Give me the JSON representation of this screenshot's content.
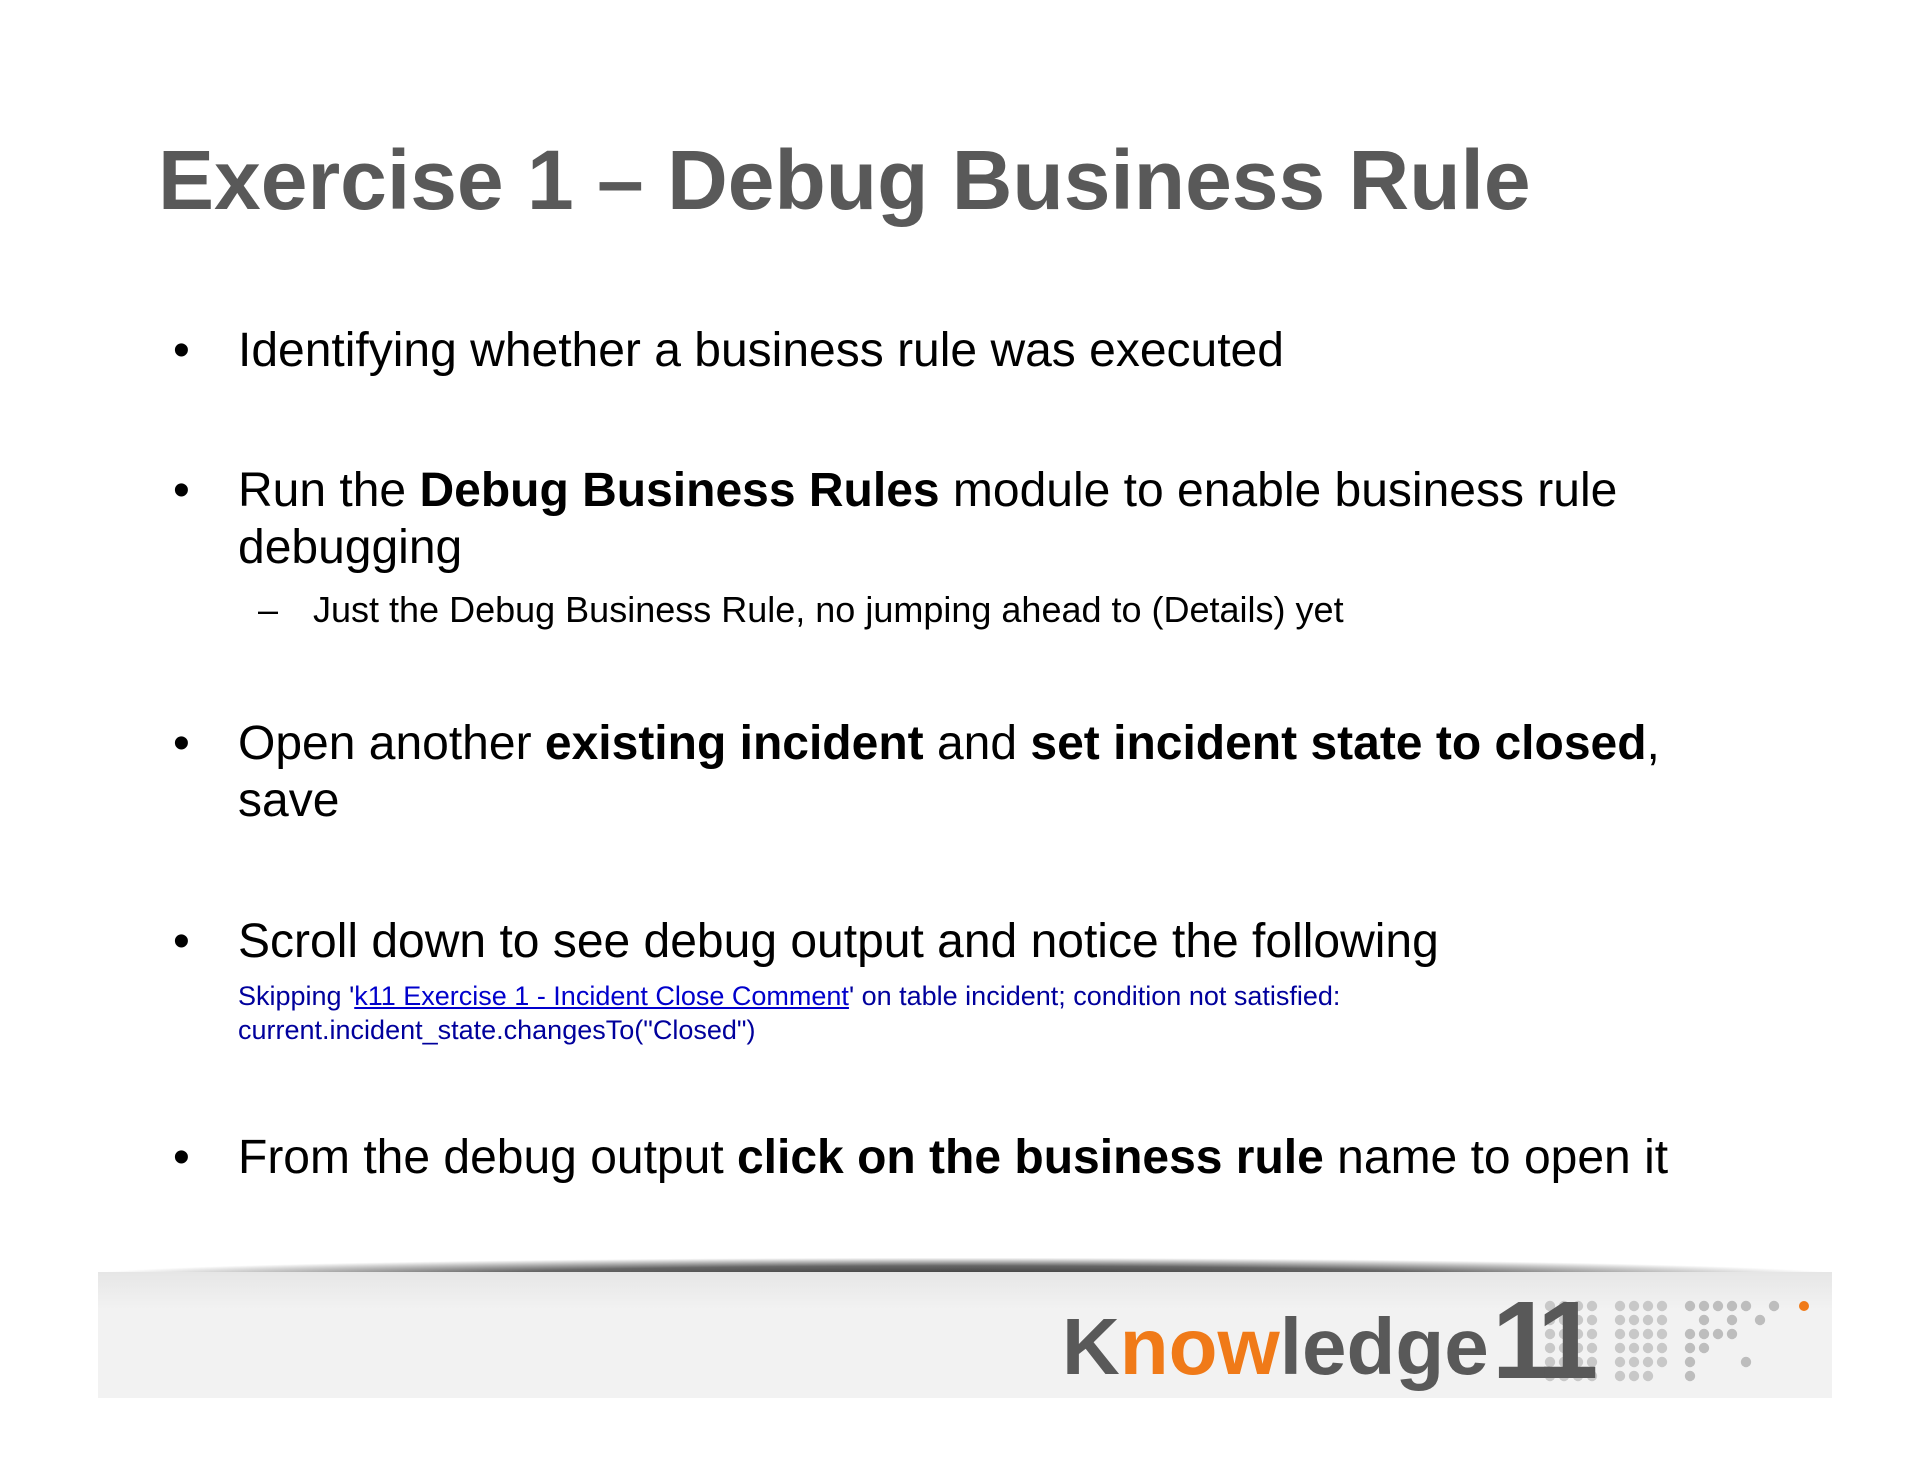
{
  "slide": {
    "title": "Exercise 1 – Debug Business Rule",
    "bullet_glyph": "•",
    "dash_glyph": "–",
    "bullets": [
      {
        "text": "Identifying whether a business rule was executed"
      },
      {
        "pre": "Run the ",
        "bold": "Debug Business Rules",
        "post": " module to enable business rule debugging",
        "sub": "Just the Debug Business Rule, no jumping ahead to (Details) yet"
      },
      {
        "pre": "Open another ",
        "bold1": "existing incident",
        "mid": " and ",
        "bold2": "set incident state to closed",
        "post": ", save"
      },
      {
        "text": "Scroll down to see debug output and notice the following",
        "debug": {
          "prefix": "Skipping '",
          "link": "k11 Exercise 1 - Incident Close Comment",
          "suffix": "' on table incident; condition not satisfied:",
          "line2": "current.incident_state.changesTo(\"Closed\")",
          "text_color": "#00009c",
          "link_color": "#0000cc"
        }
      },
      {
        "pre": "From the debug output ",
        "bold": "click on the business rule",
        "post": " name to open it"
      }
    ]
  },
  "footer": {
    "logo": {
      "k": "K",
      "now": "now",
      "ledge": "ledge",
      "num": "11"
    },
    "colors": {
      "grey": "#595959",
      "orange": "#f07a18",
      "band": "#f2f2f2"
    }
  }
}
